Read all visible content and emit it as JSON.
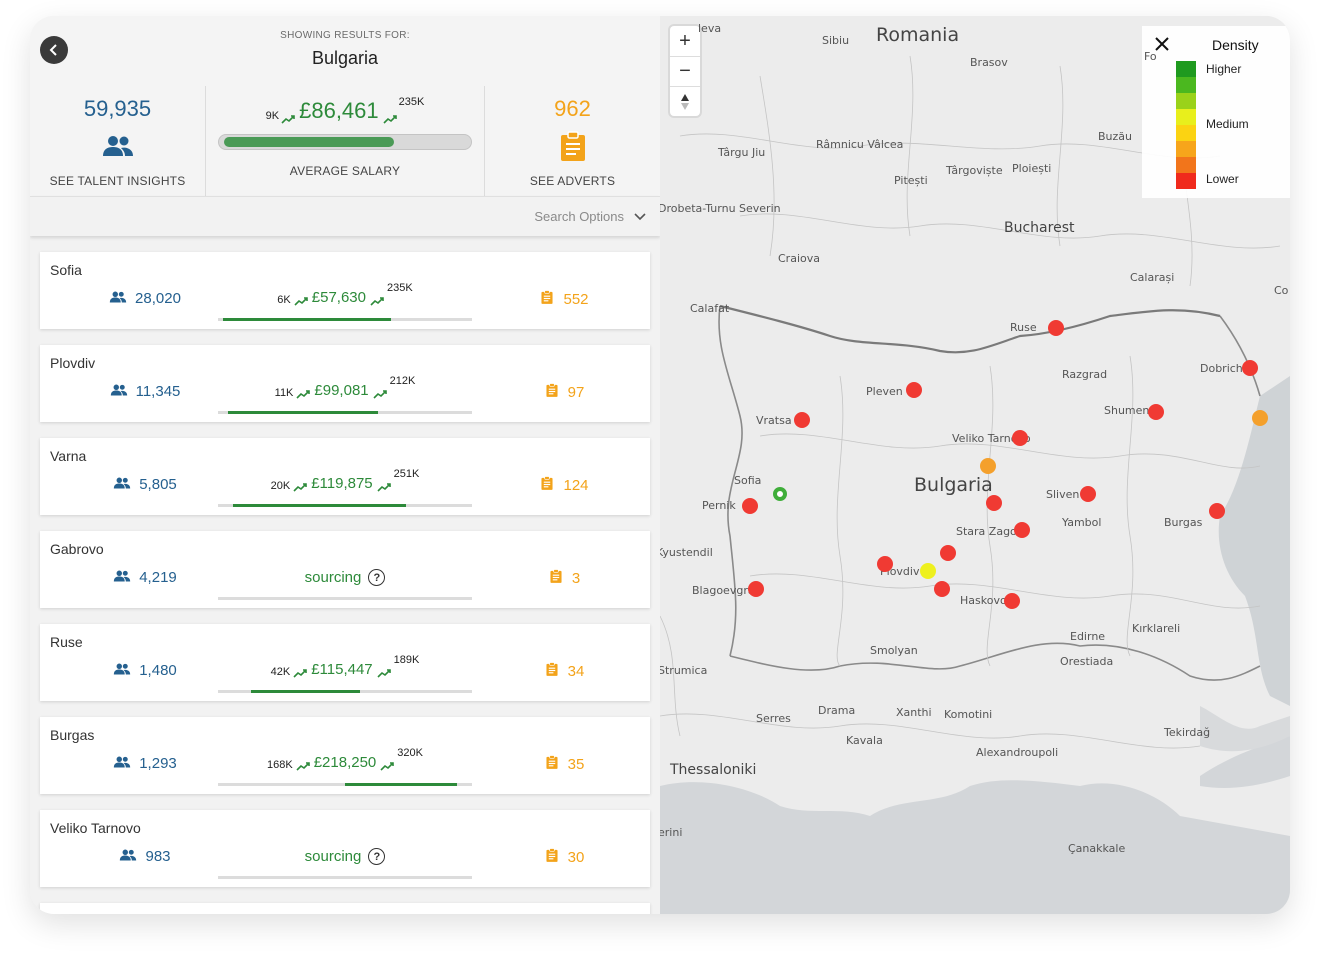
{
  "header": {
    "showing_label": "SHOWING RESULTS FOR:",
    "country": "Bulgaria",
    "talent": {
      "value": "59,935",
      "label": "SEE TALENT INSIGHTS",
      "icon": "people-icon"
    },
    "salary": {
      "min": "9K",
      "avg": "£86,461",
      "max": "235K",
      "label": "AVERAGE SALARY",
      "bar_fill": 0.69
    },
    "adverts": {
      "value": "962",
      "label": "SEE ADVERTS",
      "icon": "clipboard-icon"
    },
    "search_options": "Search Options"
  },
  "colors": {
    "blue": "#25608f",
    "green": "#2d8a3a",
    "orange": "#f3a31a",
    "red": "#f03a33"
  },
  "cards": [
    {
      "city": "Sofia",
      "talent": "28,020",
      "min": "6K",
      "avg": "£57,630",
      "max": "235K",
      "ads": "552",
      "seg": [
        0.02,
        0.68
      ]
    },
    {
      "city": "Plovdiv",
      "talent": "11,345",
      "min": "11K",
      "avg": "£99,081",
      "max": "212K",
      "ads": "97",
      "seg": [
        0.04,
        0.63
      ]
    },
    {
      "city": "Varna",
      "talent": "5,805",
      "min": "20K",
      "avg": "£119,875",
      "max": "251K",
      "ads": "124",
      "seg": [
        0.06,
        0.74
      ]
    },
    {
      "city": "Gabrovo",
      "talent": "4,219",
      "sourcing": "sourcing",
      "ads": "3"
    },
    {
      "city": "Ruse",
      "talent": "1,480",
      "min": "42K",
      "avg": "£115,447",
      "max": "189K",
      "ads": "34",
      "seg": [
        0.13,
        0.56
      ]
    },
    {
      "city": "Burgas",
      "talent": "1,293",
      "min": "168K",
      "avg": "£218,250",
      "max": "320K",
      "ads": "35",
      "seg": [
        0.5,
        0.94
      ]
    },
    {
      "city": "Veliko Tarnovo",
      "talent": "983",
      "sourcing": "sourcing",
      "ads": "30"
    }
  ],
  "map": {
    "legend": {
      "title": "Density",
      "higher": "Higher",
      "medium": "Medium",
      "lower": "Lower"
    },
    "labels": {
      "romania": "Romania",
      "sibiu": "Sibiu",
      "brasov": "Brasov",
      "targu_jiu": "Târgu Jiu",
      "ramnicu": "Râmnicu Vâlcea",
      "pitesti": "Pitești",
      "targoviste": "Târgoviște",
      "ploiesti": "Ploiești",
      "buzau": "Buzău",
      "bucharest": "Bucharest",
      "craiova": "Craiova",
      "calafat": "Calafat",
      "calarasi": "Calarași",
      "drobeta": "Drobeta-Turnu Severin",
      "ruse": "Ruse",
      "razgrad": "Razgrad",
      "dobrich": "Dobrich",
      "pleven": "Pleven",
      "vratsa": "Vratsa",
      "shumen": "Shumen",
      "veliko": "Veliko Tarnovo",
      "sofia": "Sofia",
      "bulgaria": "Bulgaria",
      "sliven": "Sliven",
      "pernik": "Pernik",
      "yambol": "Yambol",
      "burgas": "Burgas",
      "stara": "Stara Zagora",
      "kyustendil": "Kyustendil",
      "plovdiv": "Plovdiv",
      "blagoevgrad": "Blagoevgrad",
      "haskovo": "Haskovo",
      "edirne": "Edirne",
      "kirklareli": "Kırklareli",
      "orestiada": "Orestiada",
      "smolyan": "Smolyan",
      "serres": "Serres",
      "drama": "Drama",
      "xanthi": "Xanthi",
      "komotini": "Komotini",
      "kavala": "Kavala",
      "alexandroupoli": "Alexandroupoli",
      "tekirdag": "Tekirdağ",
      "thessaloniki": "Thessaloniki",
      "canakkale": "Çanakkale",
      "strumica": "Strumica",
      "fo": "Fo",
      "co": "Co",
      "leva": "leva",
      "erini": "erini"
    }
  }
}
